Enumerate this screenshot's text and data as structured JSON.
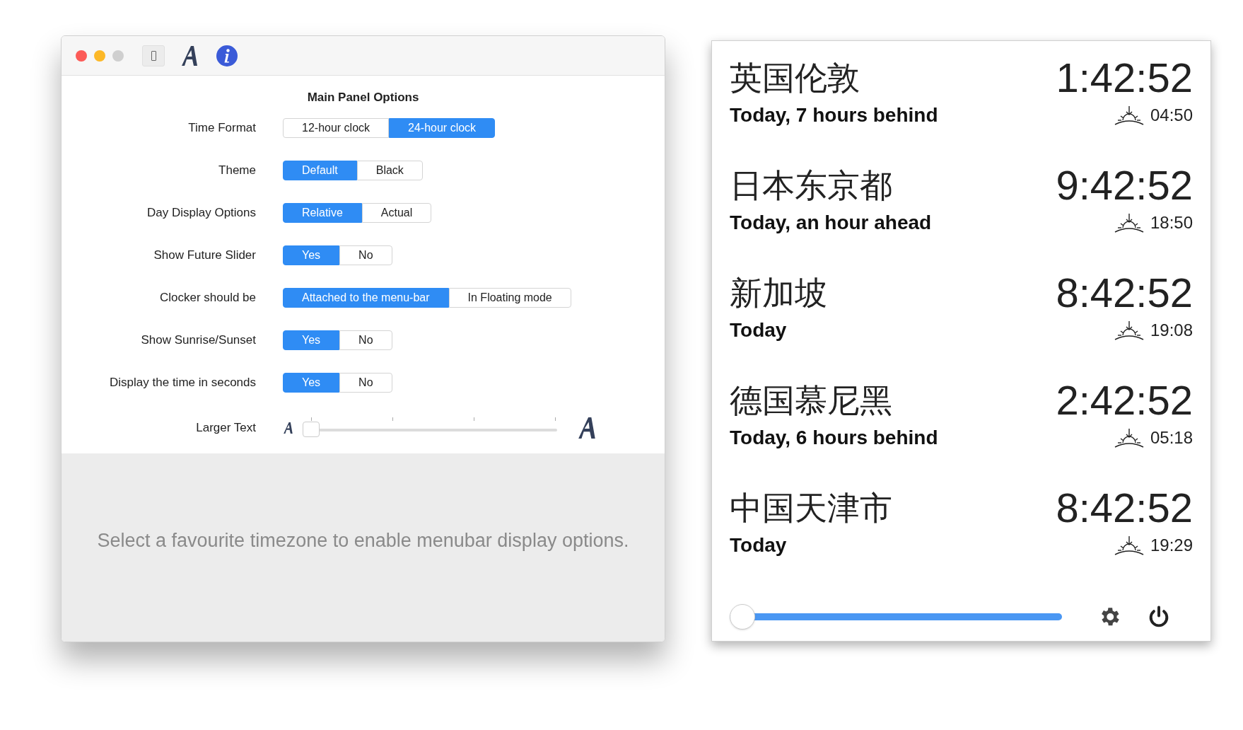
{
  "options_window": {
    "heading": "Main Panel Options",
    "settings": [
      {
        "label": "Time Format",
        "kind": "segmented",
        "options": [
          {
            "label": "12-hour clock",
            "selected": false
          },
          {
            "label": "24-hour clock",
            "selected": true
          }
        ]
      },
      {
        "label": "Theme",
        "kind": "segmented",
        "options": [
          {
            "label": "Default",
            "selected": true
          },
          {
            "label": "Black",
            "selected": false
          }
        ]
      },
      {
        "label": "Day Display Options",
        "kind": "segmented",
        "options": [
          {
            "label": "Relative",
            "selected": true
          },
          {
            "label": "Actual",
            "selected": false
          }
        ]
      },
      {
        "label": "Show Future Slider",
        "kind": "segmented",
        "options": [
          {
            "label": "Yes",
            "selected": true
          },
          {
            "label": "No",
            "selected": false
          }
        ]
      },
      {
        "label": "Clocker should be",
        "kind": "segmented",
        "options": [
          {
            "label": "Attached to the menu-bar",
            "selected": true
          },
          {
            "label": "In Floating mode",
            "selected": false
          }
        ]
      },
      {
        "label": "Show Sunrise/Sunset",
        "kind": "segmented",
        "options": [
          {
            "label": "Yes",
            "selected": true
          },
          {
            "label": "No",
            "selected": false
          }
        ]
      },
      {
        "label": "Display the time in seconds",
        "kind": "segmented",
        "options": [
          {
            "label": "Yes",
            "selected": true
          },
          {
            "label": "No",
            "selected": false
          }
        ]
      },
      {
        "label": "Larger Text",
        "kind": "slider",
        "level": 0
      }
    ],
    "message": "Select a favourite timezone to enable menubar display options."
  },
  "clock_panel": {
    "zones": [
      {
        "city": "英国伦敦",
        "time": "1:42:52",
        "day": "Today, 7 hours behind",
        "sun_time": "04:50"
      },
      {
        "city": "日本东京都",
        "time": "9:42:52",
        "day": "Today, an hour ahead",
        "sun_time": "18:50"
      },
      {
        "city": "新加坡",
        "time": "8:42:52",
        "day": "Today",
        "sun_time": "19:08"
      },
      {
        "city": "德国慕尼黑",
        "time": "2:42:52",
        "day": "Today, 6 hours behind",
        "sun_time": "05:18"
      },
      {
        "city": "中国天津市",
        "time": "8:42:52",
        "day": "Today",
        "sun_time": "19:29"
      }
    ],
    "future_slider": {
      "level": 0
    }
  }
}
